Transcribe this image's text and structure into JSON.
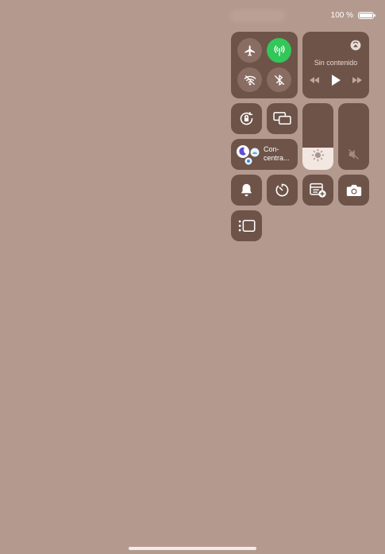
{
  "status_bar": {
    "battery_text": "100 %"
  },
  "media": {
    "title": "Sin contenido"
  },
  "focus": {
    "label_line1": "Con-",
    "label_line2": "centra..."
  },
  "sliders": {
    "brightness_level": 0.33,
    "volume_level": 0
  },
  "connectivity": {
    "airplane_mode": false,
    "cellular_data": true,
    "wifi": false,
    "bluetooth": false
  },
  "colors": {
    "background": "#b49a8e",
    "tile": "#6e5349",
    "active_green": "#32c759"
  },
  "icons": [
    "airplane-icon",
    "cellular-icon",
    "wifi-off-icon",
    "bluetooth-off-icon",
    "airplay-icon",
    "rewind-icon",
    "play-icon",
    "fast-forward-icon",
    "rotation-lock-icon",
    "screen-mirroring-icon",
    "sun-icon",
    "mute-icon",
    "focus-moon-icon",
    "bell-icon",
    "timer-icon",
    "notes-add-icon",
    "camera-icon",
    "stage-manager-icon"
  ]
}
